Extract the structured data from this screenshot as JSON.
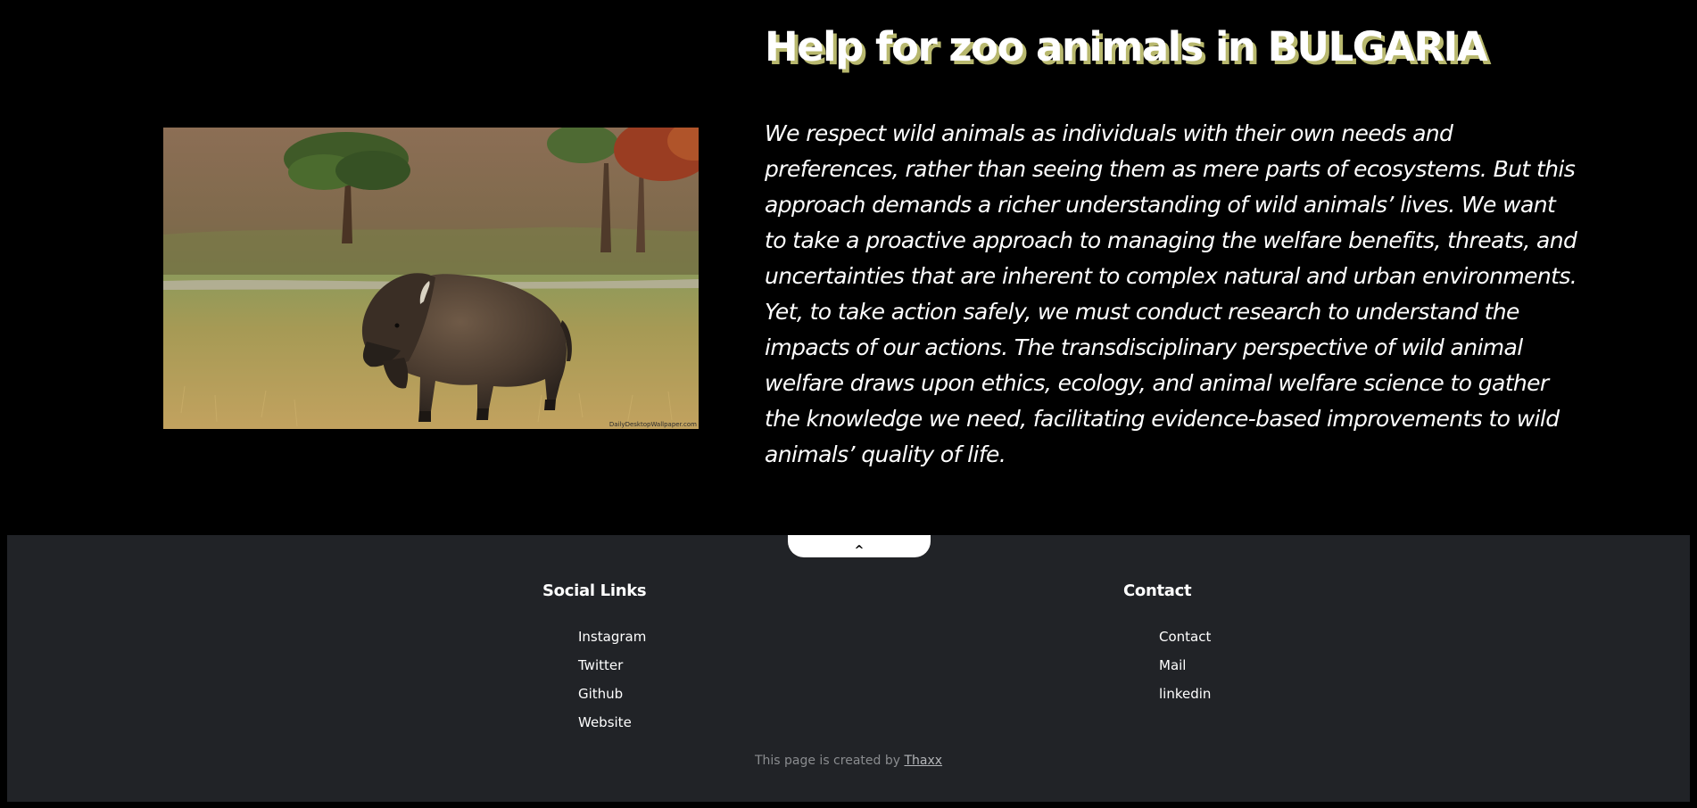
{
  "hero": {
    "title": "Help for zoo animals in BULGARIA",
    "paragraph": "We respect wild animals as individuals with their own needs and preferences, rather than seeing them as mere parts of ecosystems. But this approach demands a richer understanding of wild animals’ lives. We want to take a proactive approach to managing the welfare benefits, threats, and uncertainties that are inherent to complex natural and urban environments. Yet, to take action safely, we must conduct research to understand the impacts of our actions. The transdisciplinary perspective of wild animal welfare draws upon ethics, ecology, and animal welfare science to gather the knowledge we need, facilitating evidence-based improvements to wild animals’ quality of life.",
    "image": {
      "subject": "bison-photo",
      "watermark": "DailyDesktopWallpaper.com"
    },
    "colors": {
      "background": "#000000",
      "text": "#ffffff",
      "title_shadow": "#b8b86e"
    }
  },
  "footer": {
    "top_button_label": "^",
    "social": {
      "title": "Social Links",
      "links": [
        "Instagram",
        "Twitter",
        "Github",
        "Website"
      ]
    },
    "contact": {
      "title": "Contact",
      "links": [
        "Contact",
        "Mail",
        "linkedin"
      ]
    },
    "credit_prefix": "This page is created by ",
    "credit_author": "Thaxx",
    "colors": {
      "background": "#212327",
      "credit_text": "#8a8c8f"
    }
  }
}
